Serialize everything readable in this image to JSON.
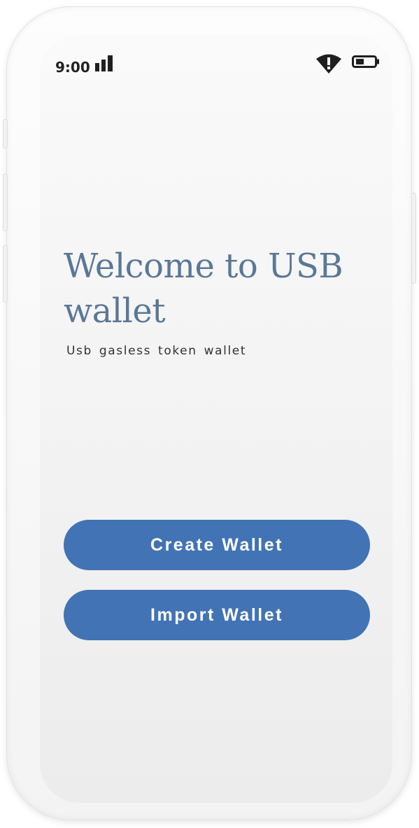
{
  "status_bar": {
    "time": "9:00",
    "icons": [
      "signal-icon",
      "wifi-warning-icon",
      "battery-icon"
    ]
  },
  "welcome": {
    "title": "Welcome to USB wallet",
    "subtitle": "Usb gasless token wallet"
  },
  "actions": {
    "create_label": "Create Wallet",
    "import_label": "Import Wallet"
  },
  "colors": {
    "primary_button": "#4273b4",
    "title_text": "#5a7896",
    "subtitle_text": "#333333",
    "screen_background": "#f4f4f4"
  }
}
